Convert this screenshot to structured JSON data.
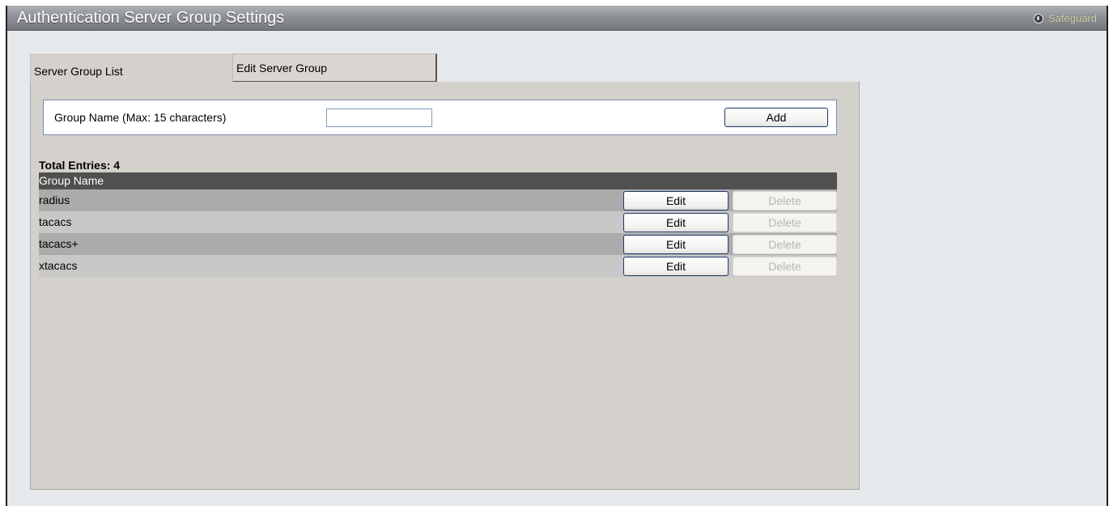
{
  "header": {
    "title": "Authentication Server Group Settings",
    "safeguard_label": "Safeguard"
  },
  "tabs": [
    {
      "label": "Server Group List",
      "active": true
    },
    {
      "label": "Edit Server Group",
      "active": false
    }
  ],
  "form": {
    "label": "Group Name  (Max: 15 characters)",
    "input_value": "",
    "add_label": "Add"
  },
  "table": {
    "total_entries": "Total Entries: 4",
    "column_header": "Group Name",
    "rows": [
      {
        "name": "radius",
        "edit": "Edit",
        "delete": "Delete"
      },
      {
        "name": "tacacs",
        "edit": "Edit",
        "delete": "Delete"
      },
      {
        "name": "tacacs+",
        "edit": "Edit",
        "delete": "Delete"
      },
      {
        "name": "xtacacs",
        "edit": "Edit",
        "delete": "Delete"
      }
    ]
  },
  "colors": {
    "titlebar": "#8e9196",
    "panel": "#d4d0cb",
    "header_row": "#505050",
    "row_odd": "#ababab",
    "row_even": "#c8c8c8"
  },
  "icons": {
    "safeguard": "safeguard-icon"
  }
}
